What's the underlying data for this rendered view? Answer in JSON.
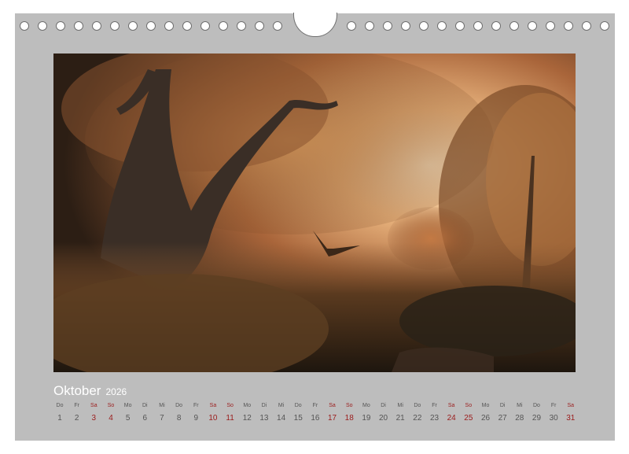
{
  "calendar": {
    "month": "Oktober",
    "year": "2026",
    "days": [
      {
        "wd": "Do",
        "num": "1",
        "weekend": false
      },
      {
        "wd": "Fr",
        "num": "2",
        "weekend": false
      },
      {
        "wd": "Sa",
        "num": "3",
        "weekend": true
      },
      {
        "wd": "So",
        "num": "4",
        "weekend": true
      },
      {
        "wd": "Mo",
        "num": "5",
        "weekend": false
      },
      {
        "wd": "Di",
        "num": "6",
        "weekend": false
      },
      {
        "wd": "Mi",
        "num": "7",
        "weekend": false
      },
      {
        "wd": "Do",
        "num": "8",
        "weekend": false
      },
      {
        "wd": "Fr",
        "num": "9",
        "weekend": false
      },
      {
        "wd": "Sa",
        "num": "10",
        "weekend": true
      },
      {
        "wd": "So",
        "num": "11",
        "weekend": true
      },
      {
        "wd": "Mo",
        "num": "12",
        "weekend": false
      },
      {
        "wd": "Di",
        "num": "13",
        "weekend": false
      },
      {
        "wd": "Mi",
        "num": "14",
        "weekend": false
      },
      {
        "wd": "Do",
        "num": "15",
        "weekend": false
      },
      {
        "wd": "Fr",
        "num": "16",
        "weekend": false
      },
      {
        "wd": "Sa",
        "num": "17",
        "weekend": true
      },
      {
        "wd": "So",
        "num": "18",
        "weekend": true
      },
      {
        "wd": "Mo",
        "num": "19",
        "weekend": false
      },
      {
        "wd": "Di",
        "num": "20",
        "weekend": false
      },
      {
        "wd": "Mi",
        "num": "21",
        "weekend": false
      },
      {
        "wd": "Do",
        "num": "22",
        "weekend": false
      },
      {
        "wd": "Fr",
        "num": "23",
        "weekend": false
      },
      {
        "wd": "Sa",
        "num": "24",
        "weekend": true
      },
      {
        "wd": "So",
        "num": "25",
        "weekend": true
      },
      {
        "wd": "Mo",
        "num": "26",
        "weekend": false
      },
      {
        "wd": "Di",
        "num": "27",
        "weekend": false
      },
      {
        "wd": "Mi",
        "num": "28",
        "weekend": false
      },
      {
        "wd": "Do",
        "num": "29",
        "weekend": false
      },
      {
        "wd": "Fr",
        "num": "30",
        "weekend": false
      },
      {
        "wd": "Sa",
        "num": "31",
        "weekend": true
      }
    ]
  },
  "colors": {
    "page_background": "#bdbdbd",
    "weekday_text": "#555555",
    "weekend_text": "#9b1c1c",
    "title_text": "#ffffff"
  },
  "photo": {
    "subject": "misty autumn forest with large tree and flying bird",
    "icon": "landscape-photo"
  }
}
